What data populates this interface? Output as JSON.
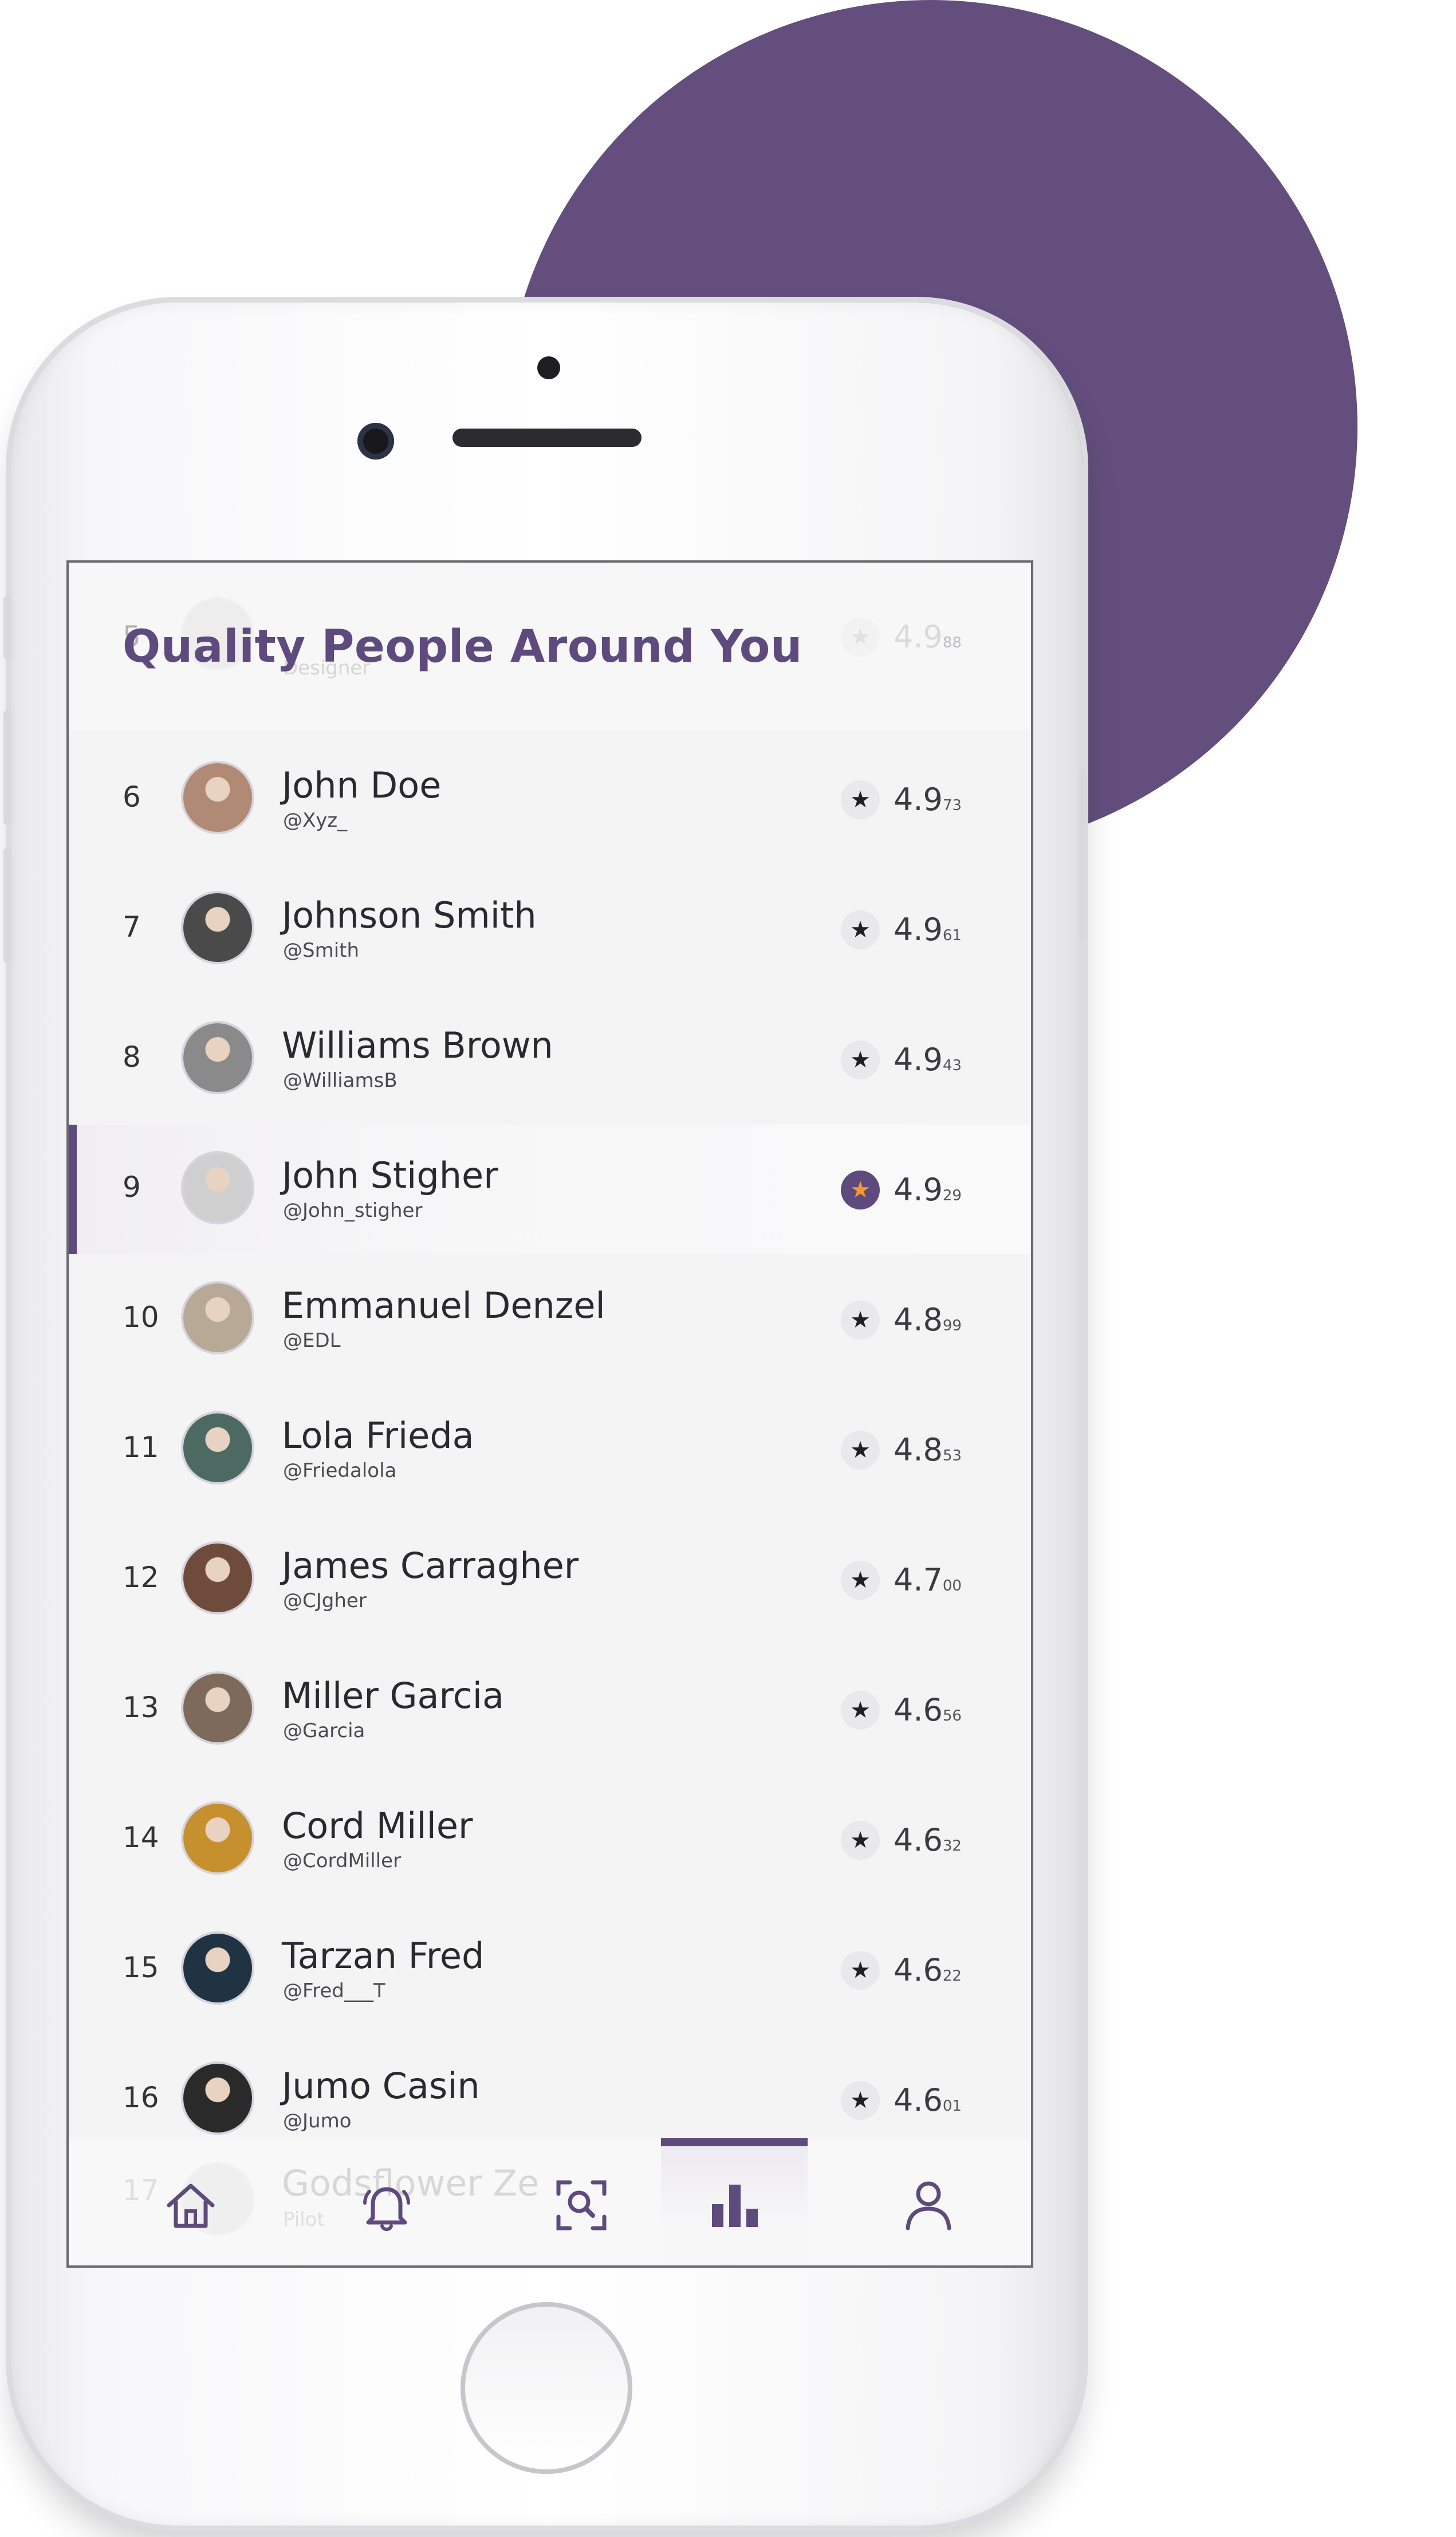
{
  "app": {
    "title": "Quality People Around You"
  },
  "colors": {
    "accent": "#5e4a7c",
    "blob": "#634e7d",
    "star_active": "#f59a2e"
  },
  "header_ghost": {
    "rank": "5",
    "subtitle": "Designer",
    "score_main": "4.9",
    "score_dec": "88"
  },
  "rows": [
    {
      "rank": "6",
      "name": "John Doe",
      "handle": "@Xyz_",
      "score_main": "4.9",
      "score_dec": "73",
      "highlight": false
    },
    {
      "rank": "7",
      "name": "Johnson Smith",
      "handle": "@Smith",
      "score_main": "4.9",
      "score_dec": "61",
      "highlight": false
    },
    {
      "rank": "8",
      "name": "Williams Brown",
      "handle": "@WilliamsB",
      "score_main": "4.9",
      "score_dec": "43",
      "highlight": false
    },
    {
      "rank": "9",
      "name": "John Stigher",
      "handle": "@John_stigher",
      "score_main": "4.9",
      "score_dec": "29",
      "highlight": true
    },
    {
      "rank": "10",
      "name": "Emmanuel Denzel",
      "handle": "@EDL",
      "score_main": "4.8",
      "score_dec": "99",
      "highlight": false
    },
    {
      "rank": "11",
      "name": "Lola Frieda",
      "handle": "@Friedalola",
      "score_main": "4.8",
      "score_dec": "53",
      "highlight": false
    },
    {
      "rank": "12",
      "name": "James Carragher",
      "handle": "@CJgher",
      "score_main": "4.7",
      "score_dec": "00",
      "highlight": false
    },
    {
      "rank": "13",
      "name": "Miller Garcia",
      "handle": "@Garcia",
      "score_main": "4.6",
      "score_dec": "56",
      "highlight": false
    },
    {
      "rank": "14",
      "name": "Cord Miller",
      "handle": "@CordMiller",
      "score_main": "4.6",
      "score_dec": "32",
      "highlight": false
    },
    {
      "rank": "15",
      "name": "Tarzan Fred",
      "handle": "@Fred___T",
      "score_main": "4.6",
      "score_dec": "22",
      "highlight": false
    },
    {
      "rank": "16",
      "name": "Jumo Casin",
      "handle": "@Jumo",
      "score_main": "4.6",
      "score_dec": "01",
      "highlight": false
    }
  ],
  "ghost17": {
    "rank": "17",
    "name": "Godsflower Ze",
    "handle": "Pilot"
  },
  "nav": {
    "items": [
      "home-icon",
      "bell-icon",
      "scan-search-icon",
      "leaderboard-icon",
      "profile-icon"
    ],
    "active": "leaderboard-icon"
  },
  "icons": {
    "star": "★"
  }
}
